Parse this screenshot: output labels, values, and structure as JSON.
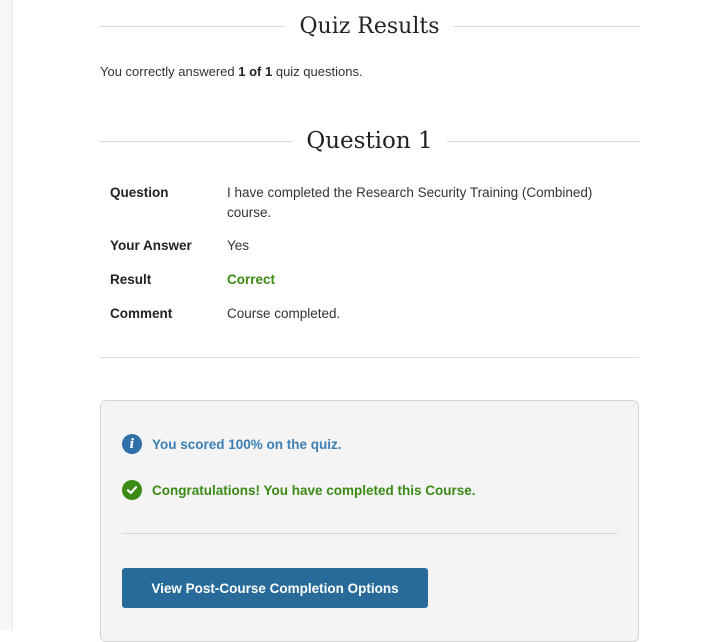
{
  "quiz_results": {
    "heading": "Quiz Results",
    "summary_prefix": "You correctly answered ",
    "summary_score": "1 of 1",
    "summary_suffix": " quiz questions."
  },
  "question": {
    "heading": "Question 1",
    "rows": [
      {
        "label": "Question",
        "value": "I have completed the Research Security Training (Combined) course."
      },
      {
        "label": "Your Answer",
        "value": "Yes"
      },
      {
        "label": "Result",
        "value": "Correct"
      },
      {
        "label": "Comment",
        "value": "Course completed."
      }
    ]
  },
  "result_box": {
    "score_message": "You scored 100% on the quiz.",
    "completion_message": "Congratulations! You have completed this Course.",
    "button_label": "View Post-Course Completion Options"
  },
  "icons": {
    "info": "info-circle-icon",
    "success": "check-circle-icon"
  },
  "colors": {
    "info_blue": "#3b7fb5",
    "success_green": "#3a8a14",
    "button_blue": "#286b9a",
    "box_bg": "#f4f4f4"
  }
}
